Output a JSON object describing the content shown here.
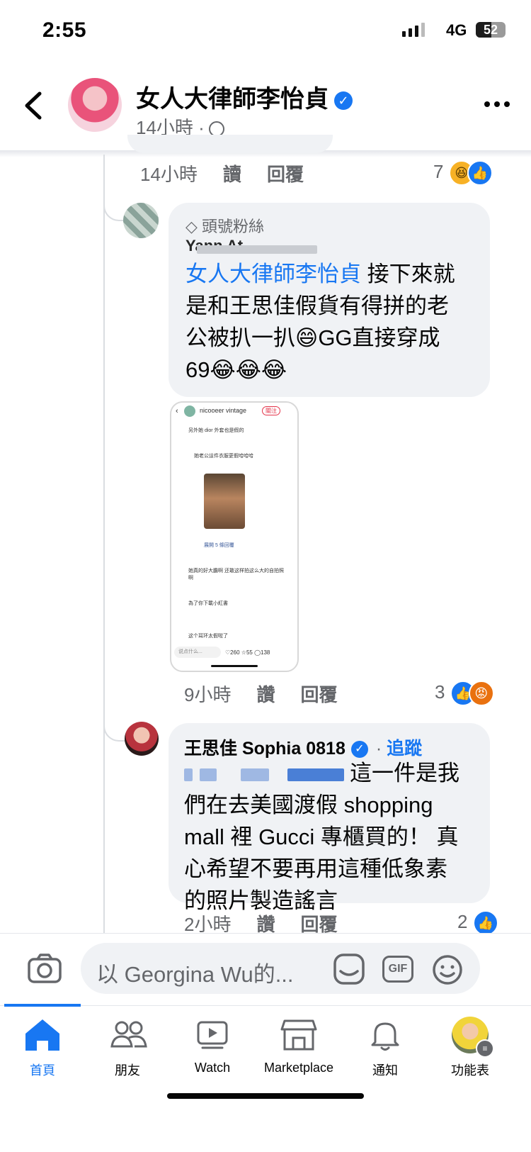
{
  "status_bar": {
    "time": "2:55",
    "network": "4G",
    "battery": "52",
    "battery_level": 0.52
  },
  "header": {
    "page_name": "女人大律師李怡貞",
    "time": "14小時 ·"
  },
  "prev_comment": {
    "time": "14小時",
    "like": "讀",
    "reply": "回覆",
    "reaction_count": "7"
  },
  "comment1": {
    "badge": "頭號粉絲",
    "author": "Yann At",
    "mention": "女人大律師李怡貞",
    "text_lines": [
      "接下來就",
      "是和王思佳假貨有得拼的老",
      "公被扒一扒😄GG直接穿成",
      "69😂😂😂"
    ],
    "time": "9小時",
    "like": "讚",
    "reply": "回覆",
    "reaction_count": "3",
    "image": {
      "account": "nicooeer vintage",
      "follow": "關注",
      "line1": "另外她 dior 外套也是假的",
      "line2": "她老公這件衣服更假哈哈哈",
      "expand": "展開 5 條回覆",
      "line3": "她真的好大膽啊 还敢这样拍这么大的自拍照啊",
      "line4": "為了你下載小紅書",
      "line5": "这个耳环太假啦了",
      "input_placeholder": "说点什么...",
      "likes": "260",
      "stars": "55",
      "comments": "138"
    }
  },
  "comment2": {
    "author": "王思佳 Sophia 0818",
    "follow": "追蹤",
    "separator": "·",
    "text_lines": [
      "這一件是我",
      "們在去美國渡假 shopping",
      "mall 裡 Gucci 專櫃買的！ 真",
      "心希望不要再用這種低象素",
      "的照片製造謠言"
    ],
    "time": "2小時",
    "like": "讚",
    "reply": "回覆",
    "reaction_count": "2"
  },
  "composer": {
    "placeholder": "以 Georgina Wu的..."
  },
  "tabs": [
    {
      "label": "首頁",
      "icon": "home-icon"
    },
    {
      "label": "朋友",
      "icon": "friends-icon"
    },
    {
      "label": "Watch",
      "icon": "watch-icon"
    },
    {
      "label": "Marketplace",
      "icon": "marketplace-icon"
    },
    {
      "label": "通知",
      "icon": "bell-icon"
    },
    {
      "label": "功能表",
      "icon": "menu-avatar-icon"
    }
  ],
  "colors": {
    "accent": "#1877f2",
    "bubble": "#f0f2f5",
    "secondary_text": "#65676b"
  }
}
